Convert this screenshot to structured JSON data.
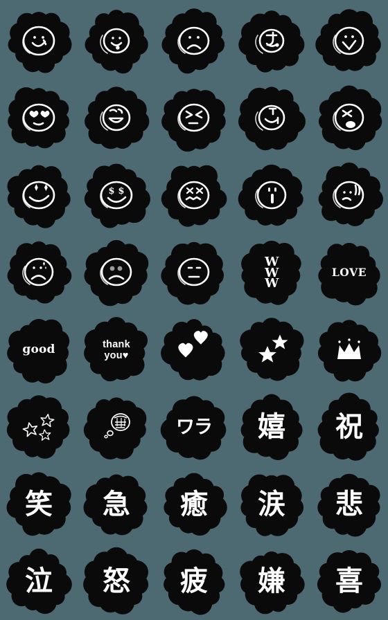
{
  "page": {
    "title": "Emoji Sticker Set",
    "background_color": "#4d6a73",
    "sticker_color": "#0a0a0a",
    "ink_color": "#ffffff",
    "columns": 5,
    "rows": 8,
    "total_stickers": 40
  },
  "stickers": [
    {
      "id": 1,
      "row": 1,
      "col": 1,
      "kind": "face",
      "name": "smiley-face",
      "text": ""
    },
    {
      "id": 2,
      "row": 1,
      "col": 2,
      "kind": "face",
      "name": "tongue-out-face",
      "text": ""
    },
    {
      "id": 3,
      "row": 1,
      "col": 3,
      "kind": "face",
      "name": "sad-frown-face",
      "text": ""
    },
    {
      "id": 4,
      "row": 1,
      "col": 4,
      "kind": "face",
      "name": "kana-face-a",
      "text": ""
    },
    {
      "id": 5,
      "row": 1,
      "col": 5,
      "kind": "face",
      "name": "happy-dot-eyes-face",
      "text": ""
    },
    {
      "id": 6,
      "row": 2,
      "col": 1,
      "kind": "face",
      "name": "heart-eyes-face",
      "text": ""
    },
    {
      "id": 7,
      "row": 2,
      "col": 2,
      "kind": "face",
      "name": "grin-tongue-face",
      "text": ""
    },
    {
      "id": 8,
      "row": 2,
      "col": 3,
      "kind": "face",
      "name": "squint-eyes-face",
      "text": ""
    },
    {
      "id": 9,
      "row": 2,
      "col": 4,
      "kind": "face",
      "name": "kana-face-b",
      "text": ""
    },
    {
      "id": 10,
      "row": 2,
      "col": 5,
      "kind": "face",
      "name": "sleeping-drool-face",
      "text": ""
    },
    {
      "id": 11,
      "row": 3,
      "col": 1,
      "kind": "face",
      "name": "sparkle-eyes-face",
      "text": ""
    },
    {
      "id": 12,
      "row": 3,
      "col": 2,
      "kind": "face",
      "name": "money-eyes-face",
      "text": ""
    },
    {
      "id": 13,
      "row": 3,
      "col": 3,
      "kind": "face",
      "name": "dead-x-eyes-face",
      "text": ""
    },
    {
      "id": 14,
      "row": 3,
      "col": 4,
      "kind": "face",
      "name": "surprised-oh-face",
      "text": ""
    },
    {
      "id": 15,
      "row": 3,
      "col": 5,
      "kind": "face",
      "name": "sweat-drop-face",
      "text": ""
    },
    {
      "id": 16,
      "row": 4,
      "col": 1,
      "kind": "face",
      "name": "crying-worried-face",
      "text": ""
    },
    {
      "id": 17,
      "row": 4,
      "col": 2,
      "kind": "face",
      "name": "gloomy-gray-eyes-face",
      "text": ""
    },
    {
      "id": 18,
      "row": 4,
      "col": 3,
      "kind": "face",
      "name": "neutral-blank-face",
      "text": ""
    },
    {
      "id": 19,
      "row": 4,
      "col": 4,
      "kind": "text",
      "name": "www-laugh-text",
      "text": "WWW"
    },
    {
      "id": 20,
      "row": 4,
      "col": 5,
      "kind": "text",
      "name": "love-text",
      "text": "LOVE"
    },
    {
      "id": 21,
      "row": 5,
      "col": 1,
      "kind": "text",
      "name": "good-text",
      "text": "good"
    },
    {
      "id": 22,
      "row": 5,
      "col": 2,
      "kind": "text",
      "name": "thank-you-text",
      "text": "thank you♥"
    },
    {
      "id": 23,
      "row": 5,
      "col": 3,
      "kind": "symbol",
      "name": "two-hearts-symbol",
      "text": ""
    },
    {
      "id": 24,
      "row": 5,
      "col": 4,
      "kind": "symbol",
      "name": "two-stars-symbol",
      "text": ""
    },
    {
      "id": 25,
      "row": 5,
      "col": 5,
      "kind": "symbol",
      "name": "crown-symbol",
      "text": ""
    },
    {
      "id": 26,
      "row": 6,
      "col": 1,
      "kind": "symbol",
      "name": "outline-stars-symbol",
      "text": ""
    },
    {
      "id": 27,
      "row": 6,
      "col": 2,
      "kind": "symbol",
      "name": "thought-bubble-symbol",
      "text": ""
    },
    {
      "id": 28,
      "row": 6,
      "col": 3,
      "kind": "text",
      "name": "wara-kana-text",
      "text": "ワラ"
    },
    {
      "id": 29,
      "row": 6,
      "col": 4,
      "kind": "text",
      "name": "ureshii-kanji-text",
      "text": "嬉"
    },
    {
      "id": 30,
      "row": 6,
      "col": 5,
      "kind": "text",
      "name": "iwai-kanji-text",
      "text": "祝"
    },
    {
      "id": 31,
      "row": 7,
      "col": 1,
      "kind": "text",
      "name": "warai-kanji-text",
      "text": "笑"
    },
    {
      "id": 32,
      "row": 7,
      "col": 2,
      "kind": "text",
      "name": "kyuu-kanji-text",
      "text": "急"
    },
    {
      "id": 33,
      "row": 7,
      "col": 3,
      "kind": "text",
      "name": "iyasu-kanji-text",
      "text": "癒"
    },
    {
      "id": 34,
      "row": 7,
      "col": 4,
      "kind": "text",
      "name": "namida-kanji-text",
      "text": "涙"
    },
    {
      "id": 35,
      "row": 7,
      "col": 5,
      "kind": "text",
      "name": "kanashii-kanji-text",
      "text": "悲"
    },
    {
      "id": 36,
      "row": 8,
      "col": 1,
      "kind": "text",
      "name": "naku-kanji-text",
      "text": "泣"
    },
    {
      "id": 37,
      "row": 8,
      "col": 2,
      "kind": "text",
      "name": "ikari-kanji-text",
      "text": "怒"
    },
    {
      "id": 38,
      "row": 8,
      "col": 3,
      "kind": "text",
      "name": "tsukare-kanji-text",
      "text": "疲"
    },
    {
      "id": 39,
      "row": 8,
      "col": 4,
      "kind": "text",
      "name": "iya-kanji-text",
      "text": "嫌"
    },
    {
      "id": 40,
      "row": 8,
      "col": 5,
      "kind": "text",
      "name": "yorokobi-kanji-text",
      "text": "喜"
    }
  ]
}
